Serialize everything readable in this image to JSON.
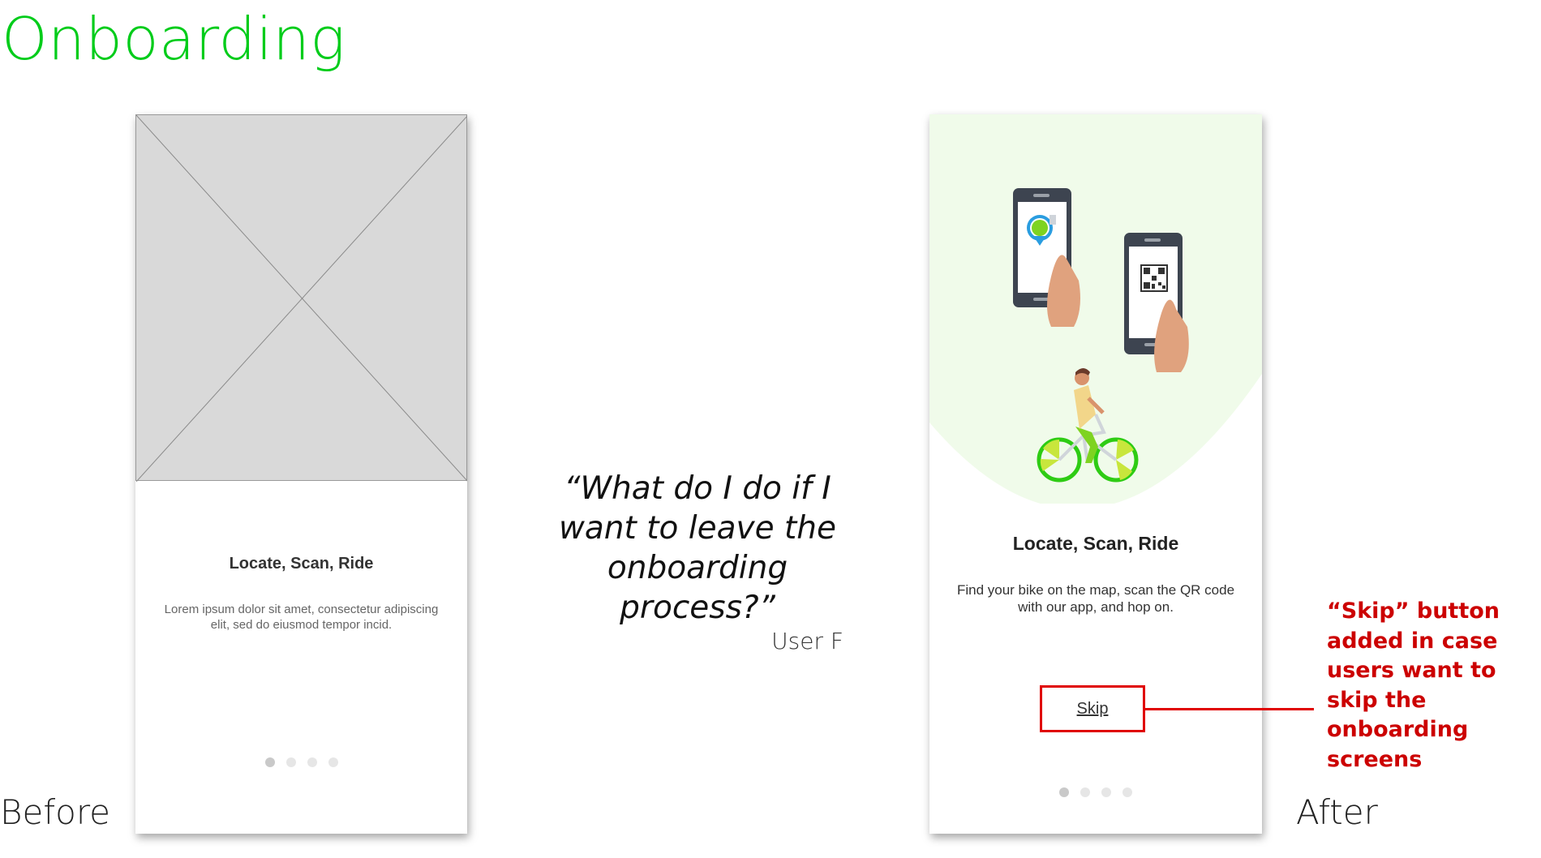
{
  "title": "Onboarding",
  "before": {
    "label": "Before",
    "heading": "Locate, Scan, Ride",
    "body": "Lorem ipsum dolor sit amet, consectetur adipiscing elit, sed do eiusmod tempor incid.",
    "pagination": {
      "total": 4,
      "active": 1
    }
  },
  "quote": {
    "text": "“What do I do if I want to leave the onboarding process?”",
    "attribution": "User F"
  },
  "after": {
    "label": "After",
    "heading": "Locate, Scan, Ride",
    "body": "Find your bike on the map, scan the QR code with our app, and hop on.",
    "skip_label": "Skip",
    "pagination": {
      "total": 4,
      "active": 1
    }
  },
  "callout": {
    "text": "“Skip” button added in case users want to skip the onboarding screens"
  },
  "colors": {
    "title_green": "#00cc1a",
    "callout_red": "#cc0000",
    "bike_green": "#2ecc14",
    "wheel_accent": "#c8e63c",
    "bg_circle": "#f0fbea"
  },
  "icons": [
    "phone-map-icon",
    "phone-qr-icon",
    "cyclist-illustration",
    "image-placeholder-icon"
  ]
}
